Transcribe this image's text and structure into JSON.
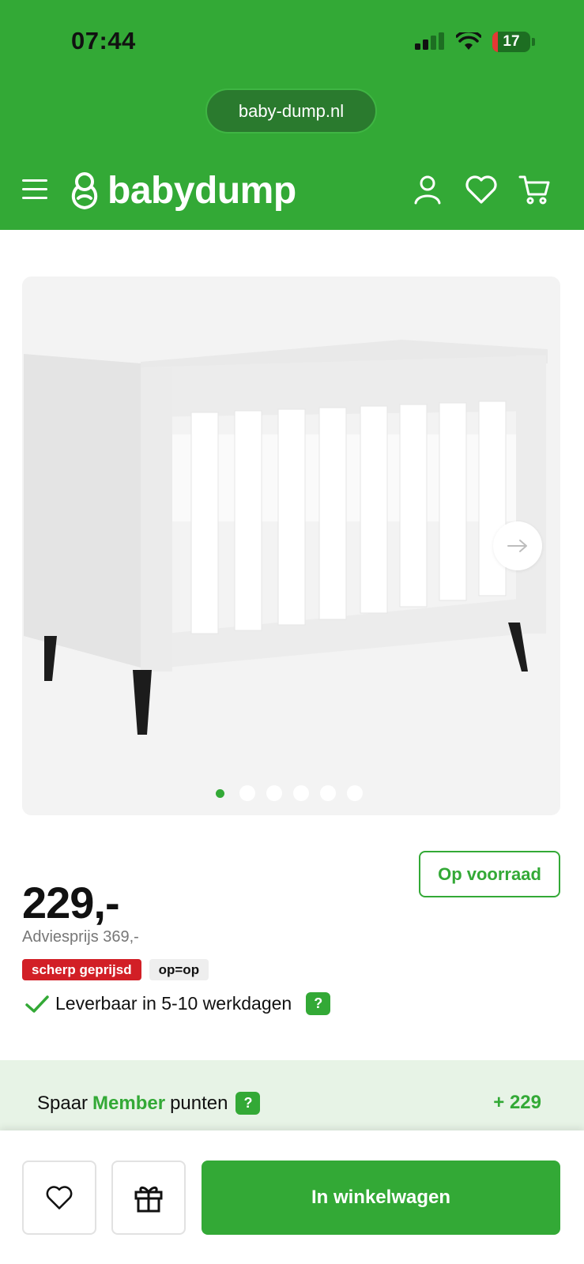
{
  "status_bar": {
    "time": "07:44",
    "battery_level": "17"
  },
  "browser": {
    "url": "baby-dump.nl"
  },
  "header": {
    "logo_text": "babydump"
  },
  "gallery": {
    "image_count": 6,
    "active_index": 0
  },
  "product": {
    "stock_label": "Op voorraad",
    "price": "229,-",
    "advice_price": "Adviesprijs 369,-",
    "tags": [
      "scherp geprijsd",
      "op=op"
    ],
    "delivery_text": "Leverbaar in 5-10 werkdagen",
    "help_symbol": "?"
  },
  "member": {
    "prefix": "Spaar",
    "brand": "Member",
    "suffix": "punten",
    "points": "+ 229"
  },
  "bottom_bar": {
    "cart_label": "In winkelwagen"
  },
  "colors": {
    "brand_green": "#33a936",
    "tag_red": "#d21f26",
    "member_bg": "#e7f3e6"
  }
}
